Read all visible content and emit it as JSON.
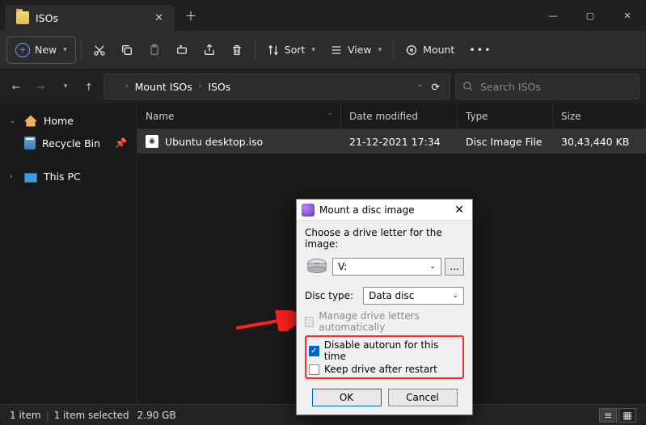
{
  "tab": {
    "title": "ISOs"
  },
  "toolbar": {
    "new_label": "New",
    "sort_label": "Sort",
    "view_label": "View",
    "mount_label": "Mount"
  },
  "breadcrumb": {
    "seg1": "Mount ISOs",
    "seg2": "ISOs"
  },
  "search": {
    "placeholder": "Search ISOs"
  },
  "sidebar": {
    "home": "Home",
    "recycle": "Recycle Bin",
    "thispc": "This PC"
  },
  "columns": {
    "name": "Name",
    "date": "Date modified",
    "type": "Type",
    "size": "Size"
  },
  "row": {
    "name": "Ubuntu desktop.iso",
    "date": "21-12-2021 17:34",
    "type": "Disc Image File",
    "size": "30,43,440 KB"
  },
  "status": {
    "count": "1 item",
    "selected": "1 item selected",
    "size": "2.90 GB"
  },
  "dialog": {
    "title": "Mount a disc image",
    "choose": "Choose a drive letter for the image:",
    "drive": "V:",
    "disc_type_label": "Disc type:",
    "disc_type_value": "Data disc",
    "manage": "Manage drive letters automatically",
    "disable_autorun": "Disable autorun for this time",
    "keep_drive": "Keep drive after restart",
    "ok": "OK",
    "cancel": "Cancel"
  }
}
